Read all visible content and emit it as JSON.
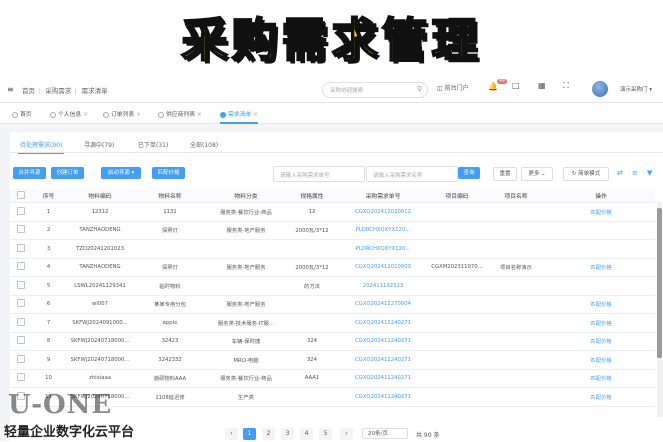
{
  "banner": {
    "title": "采购需求管理"
  },
  "topbar": {
    "menu_icon": "hamburger-icon",
    "breadcrumbs": [
      "首页",
      "采购需求",
      "需求清单"
    ],
    "search_placeholder": "采购协调搜索",
    "portal": "前台门户",
    "badge": "99",
    "user": "演示采购门 ▾"
  },
  "view_tabs": [
    {
      "label": "首页"
    },
    {
      "label": "个人信息"
    },
    {
      "label": "订单列表"
    },
    {
      "label": "供应商列表"
    },
    {
      "label": "需求清单"
    }
  ],
  "status_tabs": [
    {
      "label": "待处理需求(90)"
    },
    {
      "label": "寻源中(79)"
    },
    {
      "label": "已下单(31)"
    },
    {
      "label": "全部(108)"
    }
  ],
  "toolbar": {
    "merge": "合并寻源",
    "create_order": "创建订单",
    "start_sourcing": "启动寻源 ▾",
    "match_price": "匹配价格",
    "filter_number_placeholder": "请输入采购需求单号",
    "filter_name_placeholder": "请输入采购需求名称",
    "query": "查询",
    "reset": "重置",
    "more": "更多 ⌄",
    "simple_mode": "简单模式"
  },
  "table": {
    "columns": [
      "",
      "序号",
      "物料编码",
      "物料名称",
      "物料分类",
      "规格属性",
      "采购需求单号",
      "项目编码",
      "项目名称",
      "操作"
    ],
    "rows": [
      [
        "1",
        "12312",
        "1131",
        "服务类-餐饮行业-商品",
        "12",
        "CGXQ202412020012",
        "",
        "",
        "匹配价格"
      ],
      [
        "2",
        "TANZHAODENG",
        "探照灯",
        "服务类-地产服务",
        "2000瓦/3*12",
        "PLDRCHXQXYX120...",
        "",
        "",
        ""
      ],
      [
        "3",
        "TZD20241201023",
        "",
        "",
        "",
        "PLDRCHXQXYX120...",
        "",
        "",
        ""
      ],
      [
        "4",
        "TANZHAODENG",
        "探照灯",
        "服务类-地产服务",
        "2000瓦/3*12",
        "CGXQ202412010003",
        "CGXM202311070...",
        "项目名称演示",
        "匹配价格"
      ],
      [
        "5",
        "LSWL20241129341",
        "临时物料",
        "",
        "的方法",
        "202411192323",
        "",
        "",
        ""
      ],
      [
        "6",
        "wl007",
        "某某专用分包",
        "服务类-地产服务",
        "",
        "CGXQ202411270004",
        "",
        "",
        "匹配价格"
      ],
      [
        "7",
        "SKFWJ2024091000...",
        "apple",
        "服务类-技术服务-IT服...",
        "",
        "CGXQ202411240271",
        "",
        "",
        "匹配价格"
      ],
      [
        "8",
        "SKFWJ20240718000...",
        "32423",
        "车辆-保时捷",
        "324",
        "CGXQ202411240271",
        "",
        "",
        "匹配价格"
      ],
      [
        "9",
        "SKFWJ20240718000...",
        "3242332",
        "MRO-电脑",
        "324",
        "CGXQ202411240271",
        "",
        "",
        "匹配价格"
      ],
      [
        "10",
        "zhixiaaa",
        "施硕物料AAA",
        "服务类-餐饮行业-商品",
        "AAA1",
        "CGXQ202411240271",
        "",
        "",
        "匹配价格"
      ],
      [
        "11",
        "SKFWJ20240718000...",
        "1108延迟修",
        "生产类",
        "",
        "CGXQ202411240271",
        "",
        "",
        "匹配价格"
      ]
    ]
  },
  "pagination": {
    "prev": "‹",
    "pages": [
      "1",
      "2",
      "3",
      "4",
      "5"
    ],
    "next": "›",
    "page_size": "20条/页",
    "total": "共 90 条"
  },
  "watermark": {
    "logo": "U-ONE",
    "text": "轻量企业数字化云平台"
  },
  "colors": {
    "accent": "#409eff",
    "banner_yellow": "#f6d21a"
  }
}
